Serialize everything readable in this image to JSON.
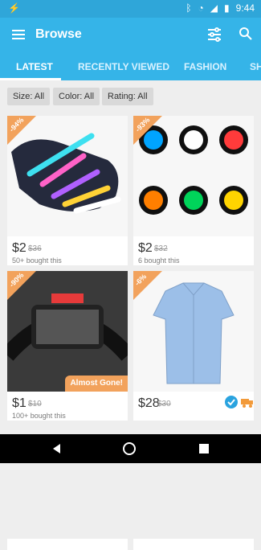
{
  "status": {
    "time": "9:44"
  },
  "app": {
    "title": "Browse"
  },
  "tabs": [
    "LATEST",
    "RECENTLY VIEWED",
    "FASHION",
    "SH"
  ],
  "filters": [
    "Size: All",
    "Color: All",
    "Rating: All"
  ],
  "products": [
    {
      "badge": "-94%",
      "price": "$2",
      "old_price": "$36",
      "bought": "50+ bought this"
    },
    {
      "badge": "-93%",
      "price": "$2",
      "old_price": "$32",
      "bought": "6 bought this"
    },
    {
      "badge": "-90%",
      "price": "$1",
      "old_price": "$10",
      "bought": "100+ bought this",
      "flag": "Almost Gone!"
    },
    {
      "badge": "-6%",
      "price": "$28",
      "old_price": "$30"
    }
  ],
  "colors": {
    "primary": "#35b4e8",
    "status": "#2fa6d9",
    "badge": "#f2a25c"
  }
}
